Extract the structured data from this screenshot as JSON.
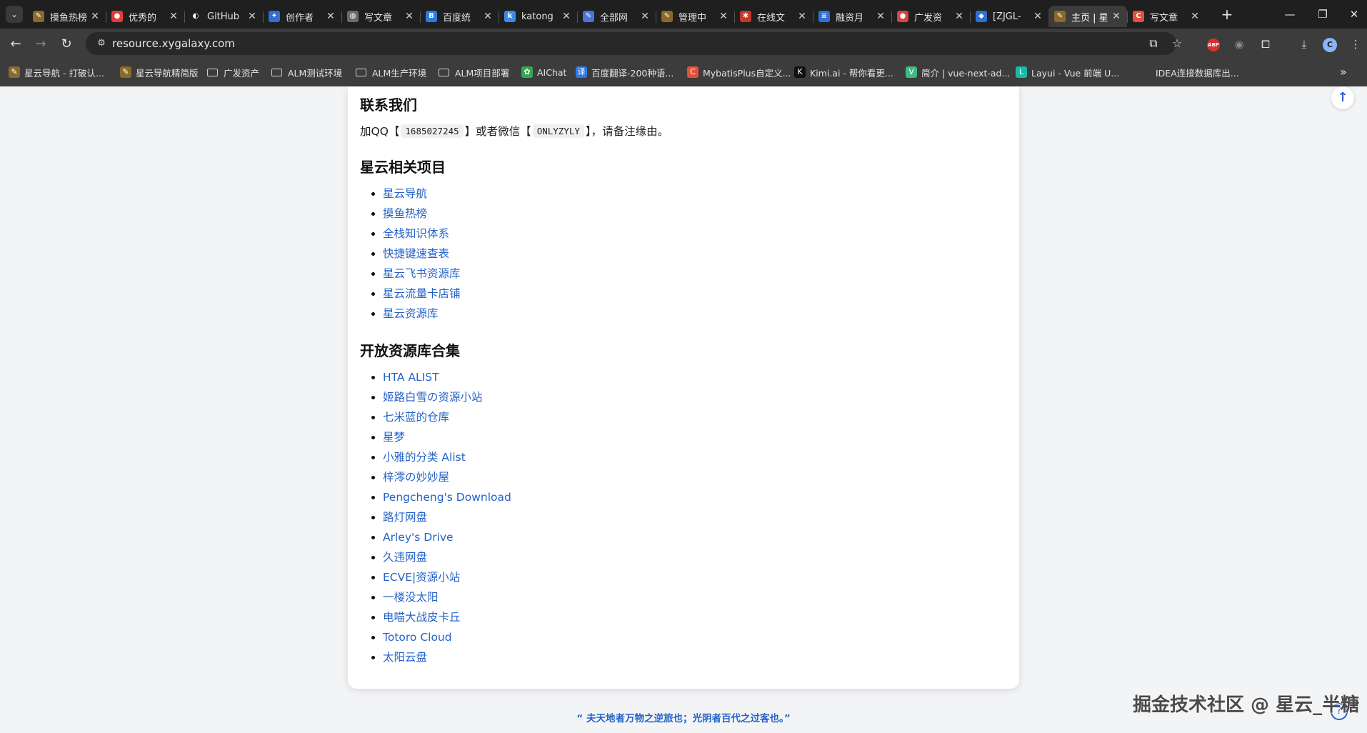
{
  "browser": {
    "tabs": [
      {
        "title": "摸鱼热榜",
        "icon": "pen-icon",
        "color": "#8a6a2a"
      },
      {
        "title": "优秀的",
        "icon": "brand-icon",
        "color": "#e33b3b"
      },
      {
        "title": "GitHub",
        "icon": "github-icon",
        "color": "#1f1f1f"
      },
      {
        "title": "创作者",
        "icon": "creator-icon",
        "color": "#2f6fd6"
      },
      {
        "title": "写文章",
        "icon": "globe-icon",
        "color": "#6b6b6b"
      },
      {
        "title": "百度统",
        "icon": "baidu-icon",
        "color": "#2c7be5"
      },
      {
        "title": "katong",
        "icon": "note-icon",
        "color": "#3a8de0"
      },
      {
        "title": "全部网",
        "icon": "pen-icon",
        "color": "#4a74d8"
      },
      {
        "title": "管理中",
        "icon": "pen-icon",
        "color": "#8a6a2a"
      },
      {
        "title": "在线文",
        "icon": "tool-icon",
        "color": "#c0392b"
      },
      {
        "title": "融资月",
        "icon": "doc-icon",
        "color": "#2f6fd6"
      },
      {
        "title": "广发资",
        "icon": "brand-icon",
        "color": "#d84242"
      },
      {
        "title": "[ZJGL-",
        "icon": "jira-icon",
        "color": "#2f6fd6"
      },
      {
        "title": "主页 | 星",
        "icon": "pen-icon",
        "color": "#8a6a2a",
        "active": true
      },
      {
        "title": "写文章",
        "icon": "csdn-icon",
        "color": "#e0503a"
      }
    ],
    "new_tab": "+",
    "url": "resource.xygalaxy.com",
    "profile_initial": "C",
    "abp_label": "ABP",
    "bookmarks": [
      {
        "label": "星云导航 - 打破认...",
        "type": "site",
        "icon": "pen-icon",
        "color": "#8a6a2a"
      },
      {
        "label": "星云导航精简版",
        "type": "site",
        "icon": "pen-icon",
        "color": "#8a6a2a"
      },
      {
        "label": "广发资产",
        "type": "folder"
      },
      {
        "label": "ALM测试环境",
        "type": "folder"
      },
      {
        "label": "ALM生产环境",
        "type": "folder"
      },
      {
        "label": "ALM项目部署",
        "type": "folder"
      },
      {
        "label": "AIChat",
        "type": "site",
        "icon": "chat-icon",
        "color": "#34a853"
      },
      {
        "label": "百度翻译-200种语...",
        "type": "site",
        "icon": "translate-icon",
        "color": "#2c7be5"
      },
      {
        "label": "MybatisPlus自定义...",
        "type": "site",
        "icon": "csdn-icon",
        "color": "#e0503a"
      },
      {
        "label": "Kimi.ai - 帮你看更...",
        "type": "site",
        "icon": "kimi-icon",
        "color": "#111111"
      },
      {
        "label": "简介 | vue-next-ad...",
        "type": "site",
        "icon": "vue-icon",
        "color": "#41b883"
      },
      {
        "label": "Layui - Vue 前端 U...",
        "type": "site",
        "icon": "layui-icon",
        "color": "#16baaa"
      },
      {
        "label": "IDEA连接数据库出...",
        "type": "site",
        "icon": "blank-icon",
        "color": "#3c3c3c"
      }
    ]
  },
  "content": {
    "contact": {
      "heading": "联系我们",
      "prefix": "加QQ【",
      "qq": "1685027245",
      "middle": "】或者微信【",
      "wechat": "ONLYZYLY",
      "suffix": "】，请备注缘由。"
    },
    "related": {
      "heading": "星云相关项目",
      "items": [
        "星云导航",
        "摸鱼热榜",
        "全栈知识体系",
        "快捷键速查表",
        "星云飞书资源库",
        "星云流量卡店铺",
        "星云资源库"
      ]
    },
    "open": {
      "heading": "开放资源库合集",
      "items": [
        "HTA ALIST",
        "姬路白雪の资源小站",
        "七米蓝的仓库",
        "星梦",
        "小雅的分类 Alist",
        "梓澪の妙妙屋",
        "Pengcheng's Download",
        "路灯网盘",
        "Arley's Drive",
        "久违网盘",
        "ECVE|资源小站",
        "一楼没太阳",
        "电喵大战皮卡丘",
        "Totoro Cloud",
        "太阳云盘"
      ]
    },
    "footer_quote": "“ 夫天地者万物之逆旅也；光阴者百代之过客也。”",
    "watermark": "掘金技术社区 @ 星云_半糖"
  },
  "colors": {
    "link": "#2563c9",
    "chrome_dark": "#1f1f1f",
    "toolbar": "#3c3c3c",
    "page_bg": "#f3f4f6"
  }
}
